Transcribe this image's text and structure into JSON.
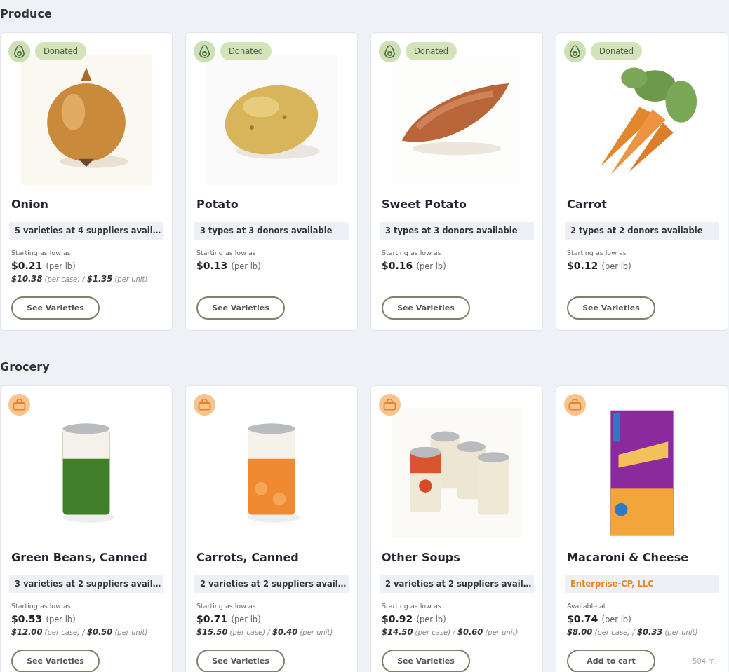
{
  "sections": [
    {
      "title": "Produce",
      "items": [
        {
          "kind": "produce",
          "tag": "Donated",
          "name": "Onion",
          "availability": {
            "text": "5 varieties at 4 suppliers avail…",
            "kind": "summary"
          },
          "price_label": "Starting as low as",
          "price": "$0.21",
          "price_unit": "(per lb)",
          "case_line": "**$10.38** (per case) / **$1.35** (per unit)",
          "button": "See Varieties"
        },
        {
          "kind": "produce",
          "tag": "Donated",
          "name": "Potato",
          "availability": {
            "text": "3 types at 3 donors available",
            "kind": "summary"
          },
          "price_label": "Starting as low as",
          "price": "$0.13",
          "price_unit": "(per lb)",
          "button": "See Varieties"
        },
        {
          "kind": "produce",
          "tag": "Donated",
          "name": "Sweet Potato",
          "availability": {
            "text": "3 types at 3 donors available",
            "kind": "summary"
          },
          "price_label": "Starting as low as",
          "price": "$0.16",
          "price_unit": "(per lb)",
          "button": "See Varieties"
        },
        {
          "kind": "produce",
          "tag": "Donated",
          "name": "Carrot",
          "availability": {
            "text": "2 types at 2 donors available",
            "kind": "summary"
          },
          "price_label": "Starting as low as",
          "price": "$0.12",
          "price_unit": "(per lb)",
          "button": "See Varieties"
        }
      ]
    },
    {
      "title": "Grocery",
      "items": [
        {
          "kind": "grocery",
          "name": "Green Beans, Canned",
          "availability": {
            "text": "3 varieties at 2 suppliers avail…",
            "kind": "summary"
          },
          "price_label": "Starting as low as",
          "price": "$0.53",
          "price_unit": "(per lb)",
          "case_line": "**$12.00** (per case) / **$0.50** (per unit)",
          "button": "See Varieties"
        },
        {
          "kind": "grocery",
          "name": "Carrots, Canned",
          "availability": {
            "text": "2 varieties at 2 suppliers avail…",
            "kind": "summary"
          },
          "price_label": "Starting as low as",
          "price": "$0.71",
          "price_unit": "(per lb)",
          "case_line": "**$15.50** (per case) / **$0.40** (per unit)",
          "button": "See Varieties"
        },
        {
          "kind": "grocery",
          "name": "Other Soups",
          "availability": {
            "text": "2 varieties at 2 suppliers avail…",
            "kind": "summary"
          },
          "price_label": "Starting as low as",
          "price": "$0.92",
          "price_unit": "(per lb)",
          "case_line": "**$14.50** (per case) / **$0.60** (per unit)",
          "button": "See Varieties"
        },
        {
          "kind": "grocery",
          "name": "Macaroni & Cheese",
          "availability": {
            "text": "Enterprise-CP, LLC",
            "kind": "supplier"
          },
          "price_label": "Available at",
          "price": "$0.74",
          "price_unit": "(per lb)",
          "case_line": "**$8.00** (per case) / **$0.33** (per unit)",
          "button": "Add to cart",
          "distance": "504 mi."
        }
      ]
    }
  ]
}
